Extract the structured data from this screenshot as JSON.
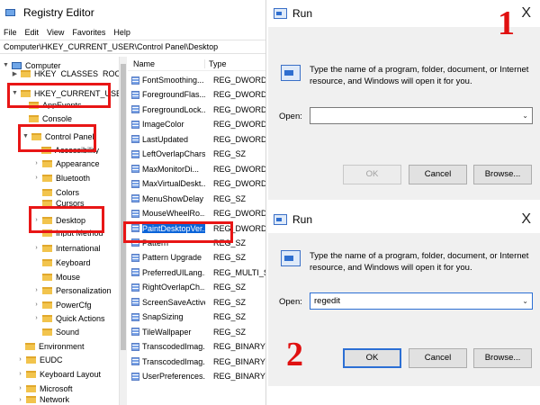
{
  "registry": {
    "title": "Registry Editor",
    "menu": [
      "File",
      "Edit",
      "View",
      "Favorites",
      "Help"
    ],
    "address": "Computer\\HKEY_CURRENT_USER\\Control Panel\\Desktop",
    "tree": {
      "computer": "Computer",
      "hkcr": "HKEY_CLASSES_ROOT",
      "hkcu": "HKEY_CURRENT_USER",
      "appevents": "AppEvents",
      "console": "Console",
      "control_panel": "Control Panel",
      "accessibility": "Accessibility",
      "appearance": "Appearance",
      "bluetooth": "Bluetooth",
      "colors": "Colors",
      "cursors": "Cursors",
      "desktop": "Desktop",
      "input_method": "Input Method",
      "international": "International",
      "keyboard": "Keyboard",
      "mouse": "Mouse",
      "personalization": "Personalization",
      "powercfg": "PowerCfg",
      "quick_actions": "Quick Actions",
      "sound": "Sound",
      "environment": "Environment",
      "eudc": "EUDC",
      "keyboard_layout": "Keyboard Layout",
      "microsoft": "Microsoft",
      "network": "Network"
    },
    "columns": {
      "name": "Name",
      "type": "Type"
    },
    "values": [
      {
        "name": "FontSmoothing...",
        "type": "REG_DWORD"
      },
      {
        "name": "ForegroundFlas...",
        "type": "REG_DWORD"
      },
      {
        "name": "ForegroundLock...",
        "type": "REG_DWORD"
      },
      {
        "name": "ImageColor",
        "type": "REG_DWORD"
      },
      {
        "name": "LastUpdated",
        "type": "REG_DWORD"
      },
      {
        "name": "LeftOverlapChars",
        "type": "REG_SZ"
      },
      {
        "name": "MaxMonitorDi...",
        "type": "REG_DWORD"
      },
      {
        "name": "MaxVirtualDeskt...",
        "type": "REG_DWORD"
      },
      {
        "name": "MenuShowDelay",
        "type": "REG_SZ"
      },
      {
        "name": "MouseWheelRo...",
        "type": "REG_DWORD"
      },
      {
        "name": "PaintDesktopVer...",
        "type": "REG_DWORD"
      },
      {
        "name": "Pattern",
        "type": "REG_SZ"
      },
      {
        "name": "Pattern Upgrade",
        "type": "REG_SZ"
      },
      {
        "name": "PreferredUILang...",
        "type": "REG_MULTI_SZ"
      },
      {
        "name": "RightOverlapCh...",
        "type": "REG_SZ"
      },
      {
        "name": "ScreenSaveActive",
        "type": "REG_SZ"
      },
      {
        "name": "SnapSizing",
        "type": "REG_SZ"
      },
      {
        "name": "TileWallpaper",
        "type": "REG_SZ"
      },
      {
        "name": "TranscodedImag...",
        "type": "REG_BINARY"
      },
      {
        "name": "TranscodedImag...",
        "type": "REG_BINARY"
      },
      {
        "name": "UserPreferences...",
        "type": "REG_BINARY"
      }
    ]
  },
  "run1": {
    "title": "Run",
    "close": "X",
    "description": "Type the name of a program, folder, document, or Internet resource, and Windows will open it for you.",
    "open_label": "Open:",
    "open_value": "",
    "ok": "OK",
    "cancel": "Cancel",
    "browse": "Browse...",
    "step": "1"
  },
  "run2": {
    "title": "Run",
    "close": "X",
    "description": "Type the name of a program, folder, document, or Internet resource, and Windows will open it for you.",
    "open_label": "Open:",
    "open_value": "regedit",
    "ok": "OK",
    "cancel": "Cancel",
    "browse": "Browse...",
    "step": "2"
  },
  "colors": {
    "highlight": "#e81616",
    "selection": "#0a64d9",
    "step_number": "#e01010"
  }
}
